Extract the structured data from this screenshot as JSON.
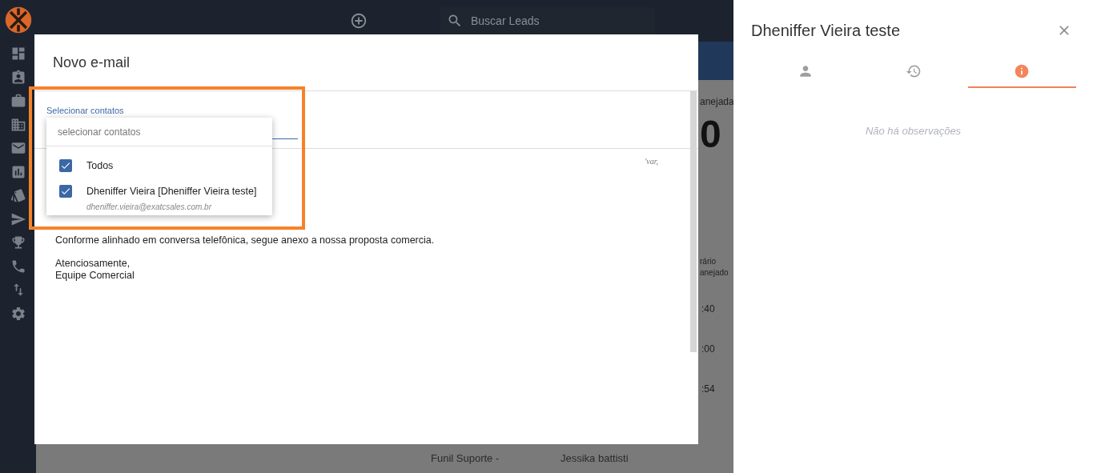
{
  "top_bar": {
    "search": {
      "placeholder": "Buscar Leads"
    }
  },
  "background_page": {
    "column_heading": "anejada",
    "big_number": "0",
    "table_heading": [
      "rário",
      "anejado"
    ],
    "times": [
      ":40",
      ":00",
      ":54"
    ],
    "last_row": [
      "Funil Suporte -",
      "Jessika battisti"
    ]
  },
  "email_dialog": {
    "title": "Novo e-mail",
    "contacts_field": {
      "label": "Selecionar contatos"
    },
    "editor_mark": "'var,",
    "body": [
      {
        "text": "Conforme alinhado em conversa telefônica, segue anexo a nossa proposta comercia."
      },
      {
        "text": "Atenciosamente,"
      },
      {
        "text": "Equipe Comercial"
      }
    ]
  },
  "contacts_dropdown": {
    "search": {
      "placeholder": "selecionar contatos"
    },
    "options": [
      {
        "label": "Todos",
        "checked": true
      },
      {
        "label": "Dheniffer Vieira [Dheniffer Vieira teste]",
        "email": "dheniffer.vieira@exatcsales.com.br",
        "checked": true
      }
    ]
  },
  "side_panel": {
    "title": "Dheniffer Vieira teste",
    "tabs": [
      {
        "kind": "person",
        "selected": false
      },
      {
        "kind": "history",
        "selected": false
      },
      {
        "kind": "info",
        "selected": true
      }
    ],
    "empty_message": "Não há observações"
  }
}
